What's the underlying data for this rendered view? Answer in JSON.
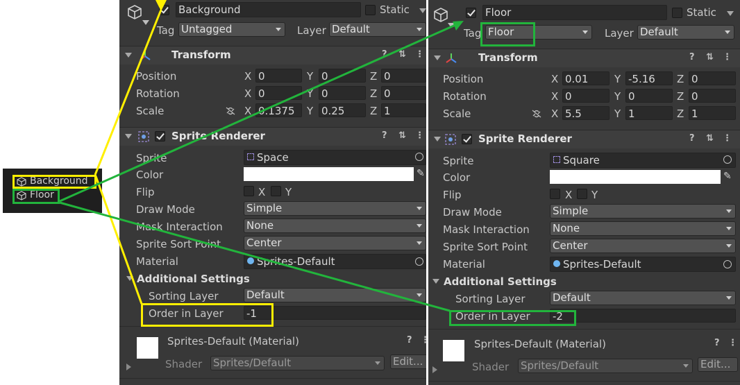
{
  "colors": {
    "panel": "#383838",
    "field": "#2a2a2a",
    "highlight_yellow": "#ffef00",
    "highlight_green": "#22b43c"
  },
  "hierarchy": {
    "items": [
      "Background",
      "Floor"
    ]
  },
  "left": {
    "name": "Background",
    "static_label": "Static",
    "tag_label": "Tag",
    "tag_value": "Untagged",
    "layer_label": "Layer",
    "layer_value": "Default",
    "transform": {
      "title": "Transform",
      "position": {
        "label": "Position",
        "x": "0",
        "y": "0",
        "z": "0"
      },
      "rotation": {
        "label": "Rotation",
        "x": "0",
        "y": "0",
        "z": "0"
      },
      "scale": {
        "label": "Scale",
        "x": "0.1375",
        "y": "0.25",
        "z": "1"
      }
    },
    "sprite_renderer": {
      "title": "Sprite Renderer",
      "sprite_label": "Sprite",
      "sprite_value": "Space",
      "color_label": "Color",
      "flip_label": "Flip",
      "flip_x": "X",
      "flip_y": "Y",
      "draw_mode_label": "Draw Mode",
      "draw_mode_value": "Simple",
      "mask_label": "Mask Interaction",
      "mask_value": "None",
      "sort_point_label": "Sprite Sort Point",
      "sort_point_value": "Center",
      "material_label": "Material",
      "material_value": "Sprites-Default",
      "additional": "Additional Settings",
      "sorting_layer_label": "Sorting Layer",
      "sorting_layer_value": "Default",
      "order_label": "Order in Layer",
      "order_value": "-1"
    },
    "material": {
      "name": "Sprites-Default (Material)",
      "shader_label": "Shader",
      "shader_value": "Sprites/Default",
      "edit": "Edit..."
    }
  },
  "right": {
    "name": "Floor",
    "static_label": "Static",
    "tag_label": "Tag",
    "tag_value": "Floor",
    "layer_label": "Layer",
    "layer_value": "Default",
    "transform": {
      "title": "Transform",
      "position": {
        "label": "Position",
        "x": "0.01",
        "y": "-5.16",
        "z": "0"
      },
      "rotation": {
        "label": "Rotation",
        "x": "0",
        "y": "0",
        "z": "0"
      },
      "scale": {
        "label": "Scale",
        "x": "5.5",
        "y": "1",
        "z": "1"
      }
    },
    "sprite_renderer": {
      "title": "Sprite Renderer",
      "sprite_label": "Sprite",
      "sprite_value": "Square",
      "color_label": "Color",
      "flip_label": "Flip",
      "flip_x": "X",
      "flip_y": "Y",
      "draw_mode_label": "Draw Mode",
      "draw_mode_value": "Simple",
      "mask_label": "Mask Interaction",
      "mask_value": "None",
      "sort_point_label": "Sprite Sort Point",
      "sort_point_value": "Center",
      "material_label": "Material",
      "material_value": "Sprites-Default",
      "additional": "Additional Settings",
      "sorting_layer_label": "Sorting Layer",
      "sorting_layer_value": "Default",
      "order_label": "Order in Layer",
      "order_value": "-2"
    },
    "material": {
      "name": "Sprites-Default (Material)",
      "shader_label": "Shader",
      "shader_value": "Sprites/Default",
      "edit": "Edit..."
    }
  },
  "axes": {
    "x": "X",
    "y": "Y",
    "z": "Z"
  },
  "icons": {
    "help": "?",
    "more": "⋮",
    "presets": "⇅"
  }
}
